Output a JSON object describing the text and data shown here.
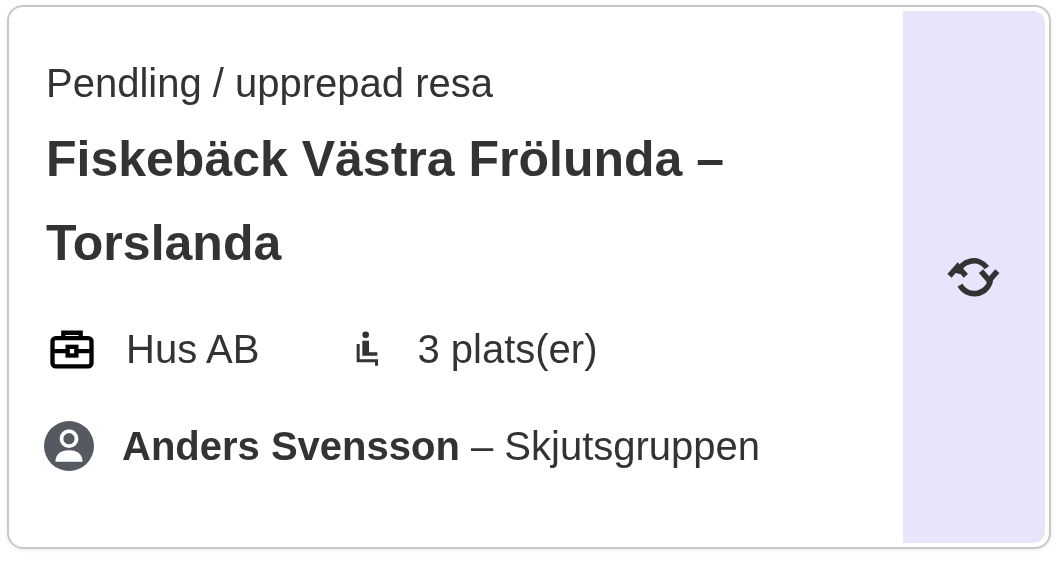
{
  "card": {
    "category": "Pendling / upprepad resa",
    "title": "Fiskebäck Västra Frölunda – Torslanda",
    "details": [
      {
        "kind": "company",
        "text": "Hus AB"
      },
      {
        "kind": "seats",
        "text": "3 plats(er)"
      }
    ],
    "driver": "**Anders Svensson** – Skjutsgruppen"
  }
}
